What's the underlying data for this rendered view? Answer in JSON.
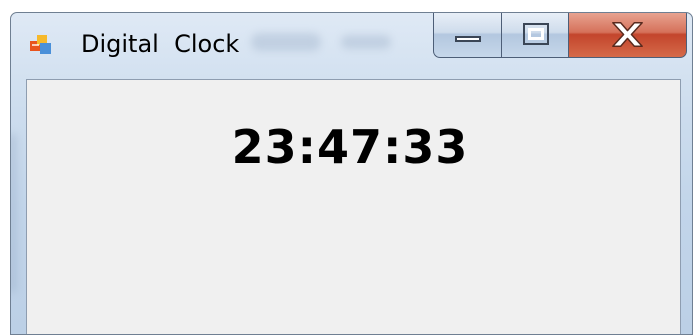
{
  "window": {
    "title": "Digital  Clock",
    "icon": "windows-form-icon"
  },
  "caption_buttons": {
    "minimize": "minimize-icon",
    "maximize": "maximize-icon",
    "close": "close-icon"
  },
  "clock": {
    "time": "23:47:33"
  },
  "colors": {
    "client_background": "#f0f0f0",
    "close_button": "#c3452c",
    "frame": "#c2d5ea"
  }
}
